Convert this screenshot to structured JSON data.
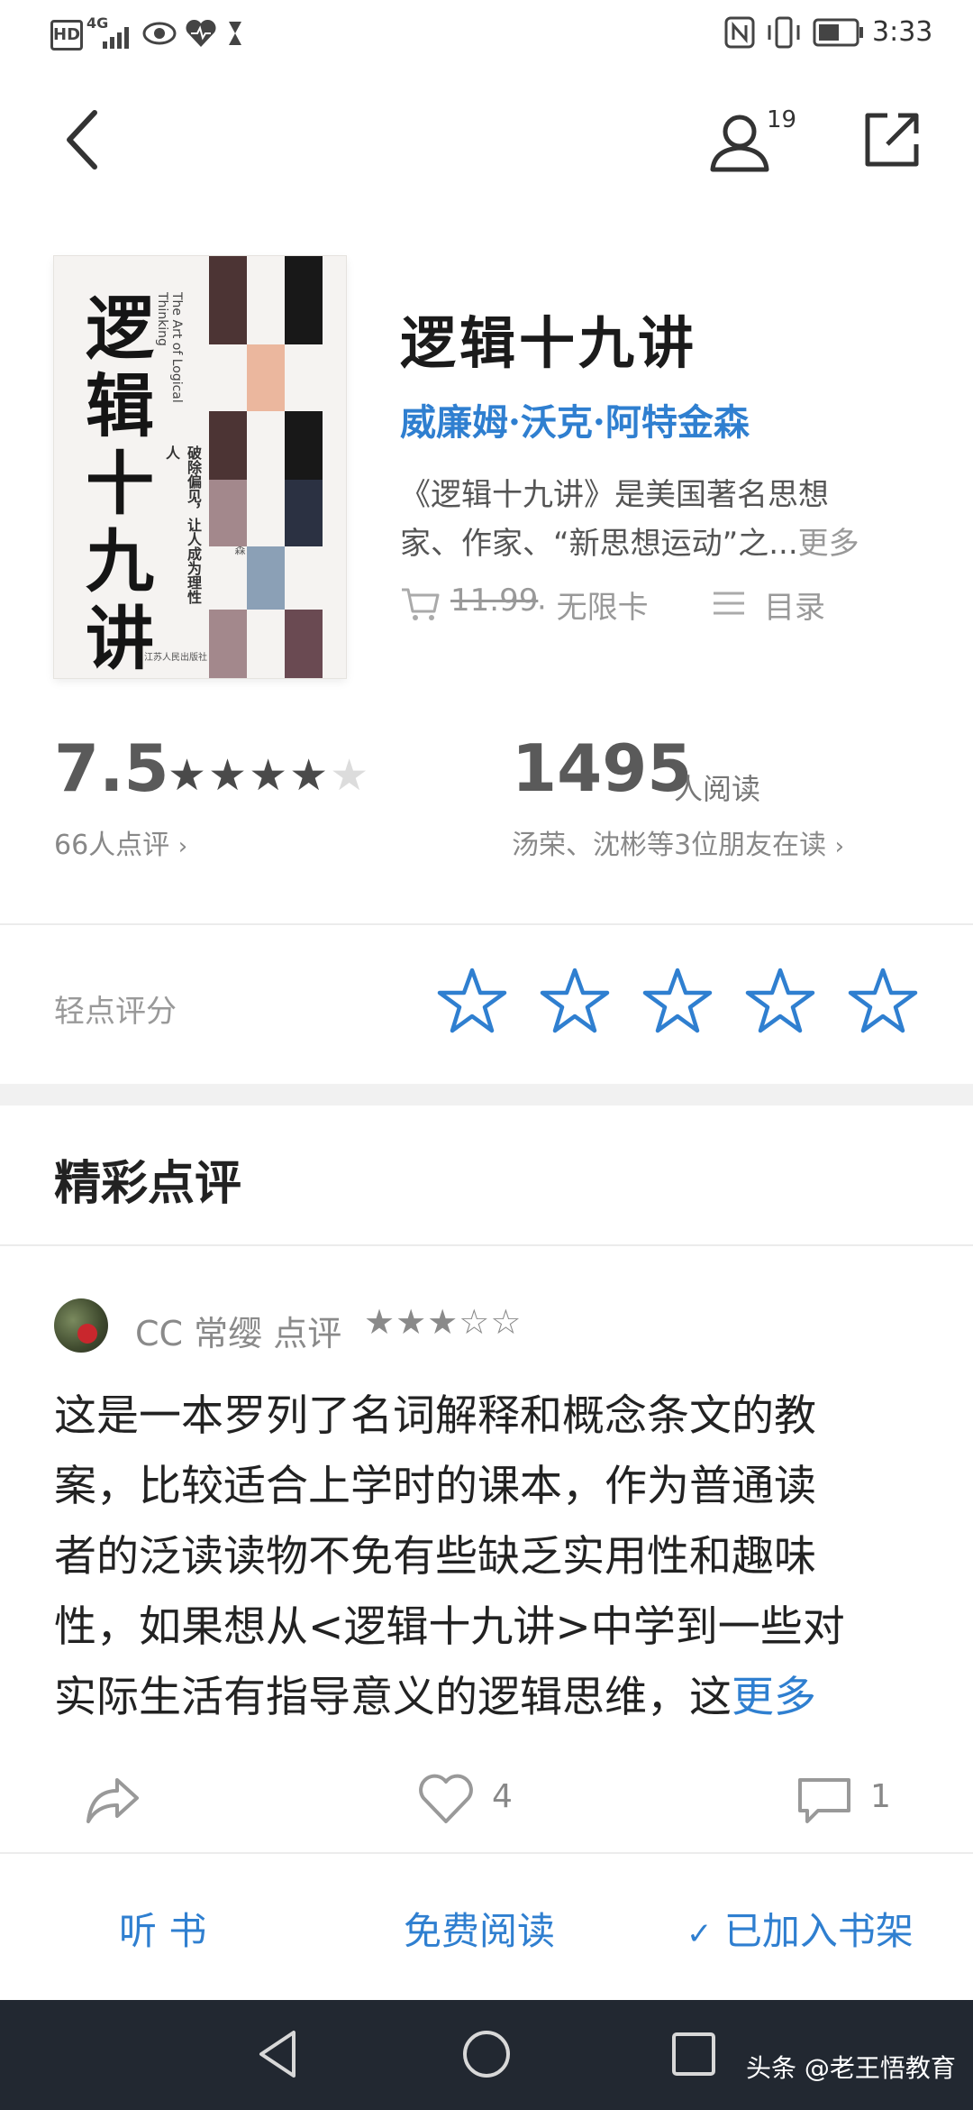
{
  "status_bar": {
    "left_hd": "HD",
    "signal_label": "4G",
    "time": "3:33"
  },
  "header": {
    "friends_count": "19"
  },
  "cover": {
    "title_chars": [
      "逻",
      "辑",
      "十",
      "九",
      "讲"
    ],
    "english": "The Art of Logical Thinking",
    "subtitle": "破除偏见，让人成为理性人",
    "author_line": "［美］威廉姆·沃克·阿特金森",
    "publisher": "江苏人民出版社"
  },
  "book": {
    "title": "逻辑十九讲",
    "author": "威廉姆·沃克·阿特金森",
    "description_line1": "《逻辑十九讲》是美国著名思想",
    "description_line2": "家、作家、“新思想运动”之...",
    "description_more": "更多",
    "price": "11.99",
    "price_suffix": "· 无限卡",
    "toc_label": "目录"
  },
  "stats": {
    "score": "7.5",
    "stars_filled": 4,
    "stars_total": 5,
    "ratings_count_label": "66人点评",
    "readers": "1495",
    "readers_label": "人阅读",
    "friends_reading": "汤荣、沈彬等3位朋友在读"
  },
  "rate": {
    "label": "轻点评分",
    "stars": 5
  },
  "reviews_section": {
    "title": "精彩点评"
  },
  "review": {
    "reviewer": "CC 常缨",
    "action": "点评",
    "stars_filled": 3,
    "stars_total": 5,
    "lines": [
      "这是一本罗列了名词解释和概念条文的教",
      "案，比较适合上学时的课本，作为普通读",
      "者的泛读读物不免有些缺乏实用性和趣味",
      "性，如果想从<逻辑十九讲>中学到一些对",
      "实际生活有指导意义的逻辑思维，这"
    ],
    "more": "更多",
    "likes": "4",
    "comments": "1"
  },
  "bottom_actions": {
    "listen": "听 书",
    "free_read": "免费阅读",
    "shelf": "已加入书架"
  },
  "watermark": "头条 @老王悟教育",
  "colors": {
    "accent": "#2f7fd0",
    "navbar": "#222831"
  }
}
